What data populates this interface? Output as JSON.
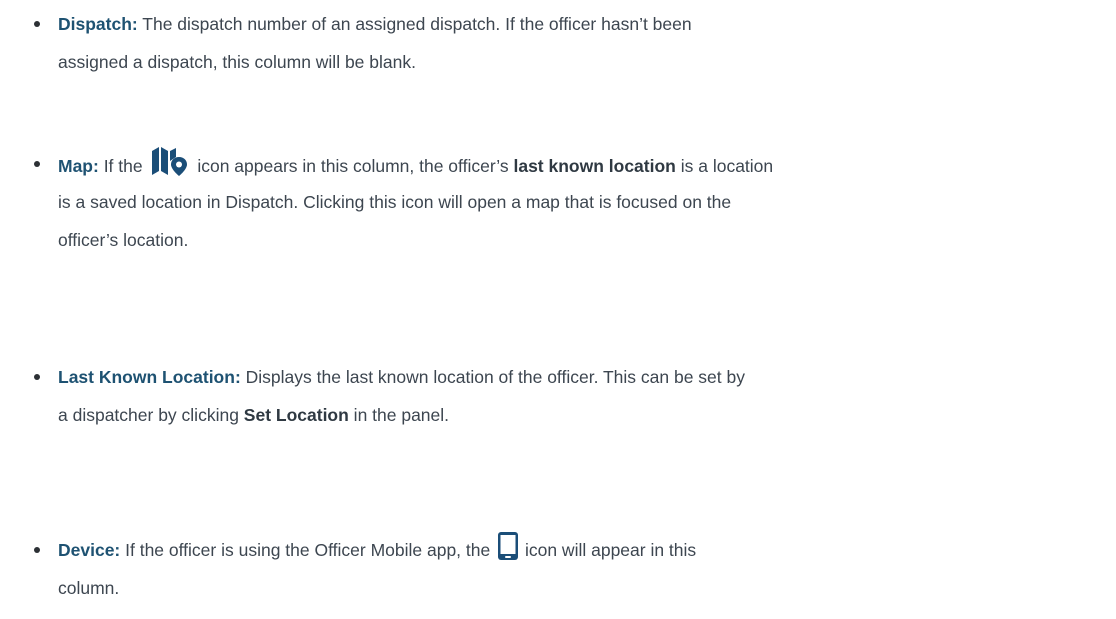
{
  "items": [
    {
      "term": "Dispatch:",
      "lines": [
        " The dispatch number of an assigned dispatch. If the officer hasn’t been",
        "assigned a dispatch, this column will be blank."
      ]
    },
    {
      "term": "Map:",
      "line1_a": " If the ",
      "line1_icon": "map-location-icon",
      "line1_b": " icon appears in this column, the officer’s ",
      "line1_bold": "last known location",
      "line1_c": " is a location",
      "line2": "is a saved location in Dispatch. Clicking this icon will open a map that is focused on the",
      "line3": "officer’s location."
    },
    {
      "term": "Last Known Location:",
      "line1": " Displays the last known location of the officer. This can be set by",
      "line2_a": "a dispatcher by clicking ",
      "line2_bold": "Set Location",
      "line2_b": " in the panel."
    },
    {
      "term": "Device:",
      "line1_a": " If the officer is using the Officer Mobile app, the ",
      "line1_icon": "mobile-phone-icon",
      "line1_b": " icon will appear in this",
      "line2": "column."
    }
  ],
  "colors": {
    "text": "#3d4650",
    "term": "#1e5272",
    "icon": "#1b4e78"
  }
}
